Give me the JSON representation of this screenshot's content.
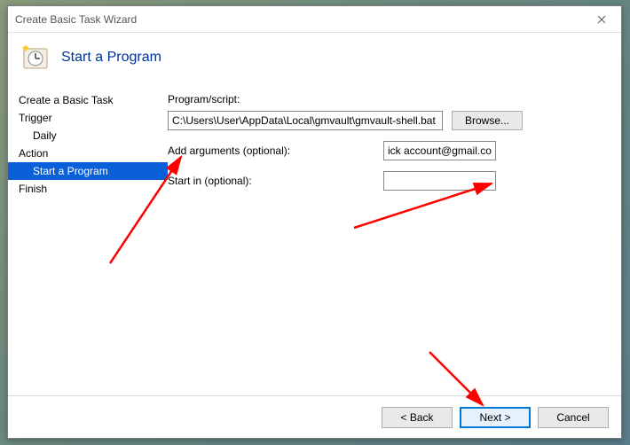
{
  "window": {
    "title": "Create Basic Task Wizard"
  },
  "header": {
    "title": "Start a Program"
  },
  "nav": {
    "items": [
      {
        "label": "Create a Basic Task",
        "indent": 0,
        "selected": false
      },
      {
        "label": "Trigger",
        "indent": 0,
        "selected": false
      },
      {
        "label": "Daily",
        "indent": 1,
        "selected": false
      },
      {
        "label": "Action",
        "indent": 0,
        "selected": false
      },
      {
        "label": "Start a Program",
        "indent": 1,
        "selected": true
      },
      {
        "label": "Finish",
        "indent": 0,
        "selected": false
      }
    ]
  },
  "form": {
    "program_label": "Program/script:",
    "program_value": "C:\\Users\\User\\AppData\\Local\\gmvault\\gmvault-shell.bat",
    "browse_label": "Browse...",
    "arguments_label": "Add arguments (optional):",
    "arguments_value": "ick account@gmail.com",
    "startin_label": "Start in (optional):",
    "startin_value": ""
  },
  "buttons": {
    "back": "< Back",
    "next": "Next >",
    "cancel": "Cancel"
  }
}
